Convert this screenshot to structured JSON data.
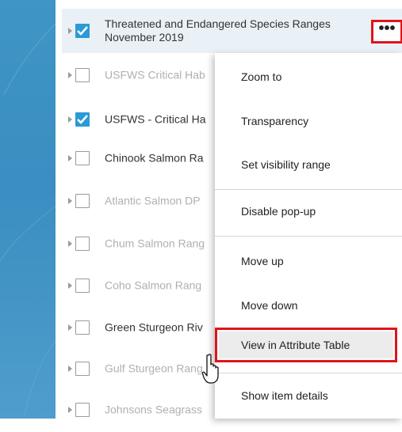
{
  "layers": [
    {
      "label_line1": "Threatened and Endangered Species Ranges",
      "label_line2": "November 2019",
      "checked": true,
      "dimmed": false
    },
    {
      "label": "USFWS Critical Hab",
      "checked": false,
      "dimmed": true
    },
    {
      "label": "USFWS - Critical Ha",
      "checked": true,
      "dimmed": false
    },
    {
      "label": "Chinook Salmon Ra",
      "checked": false,
      "dimmed": false
    },
    {
      "label": "Atlantic Salmon DP",
      "checked": false,
      "dimmed": true
    },
    {
      "label": "Chum Salmon Rang",
      "checked": false,
      "dimmed": true
    },
    {
      "label": "Coho Salmon Rang",
      "checked": false,
      "dimmed": true
    },
    {
      "label": "Green Sturgeon Riv",
      "checked": false,
      "dimmed": false
    },
    {
      "label": "Gulf Sturgeon Rang",
      "checked": false,
      "dimmed": true
    },
    {
      "label": "Johnsons Seagrass",
      "checked": false,
      "dimmed": true
    }
  ],
  "more_button": {
    "icon": "more-horizontal-icon",
    "glyph": "•••"
  },
  "context_menu": {
    "items": [
      {
        "label": "Zoom to"
      },
      {
        "label": "Transparency"
      },
      {
        "label": "Set visibility range"
      },
      {
        "label": "Disable pop-up"
      },
      {
        "label": "Move up"
      },
      {
        "label": "Move down"
      },
      {
        "label": "View in Attribute Table",
        "highlighted": true
      },
      {
        "label": "Show item details"
      }
    ]
  },
  "colors": {
    "checkbox_checked": "#2b9ad5",
    "highlight_border": "#e0141a",
    "map_water": "#3f95c6"
  }
}
